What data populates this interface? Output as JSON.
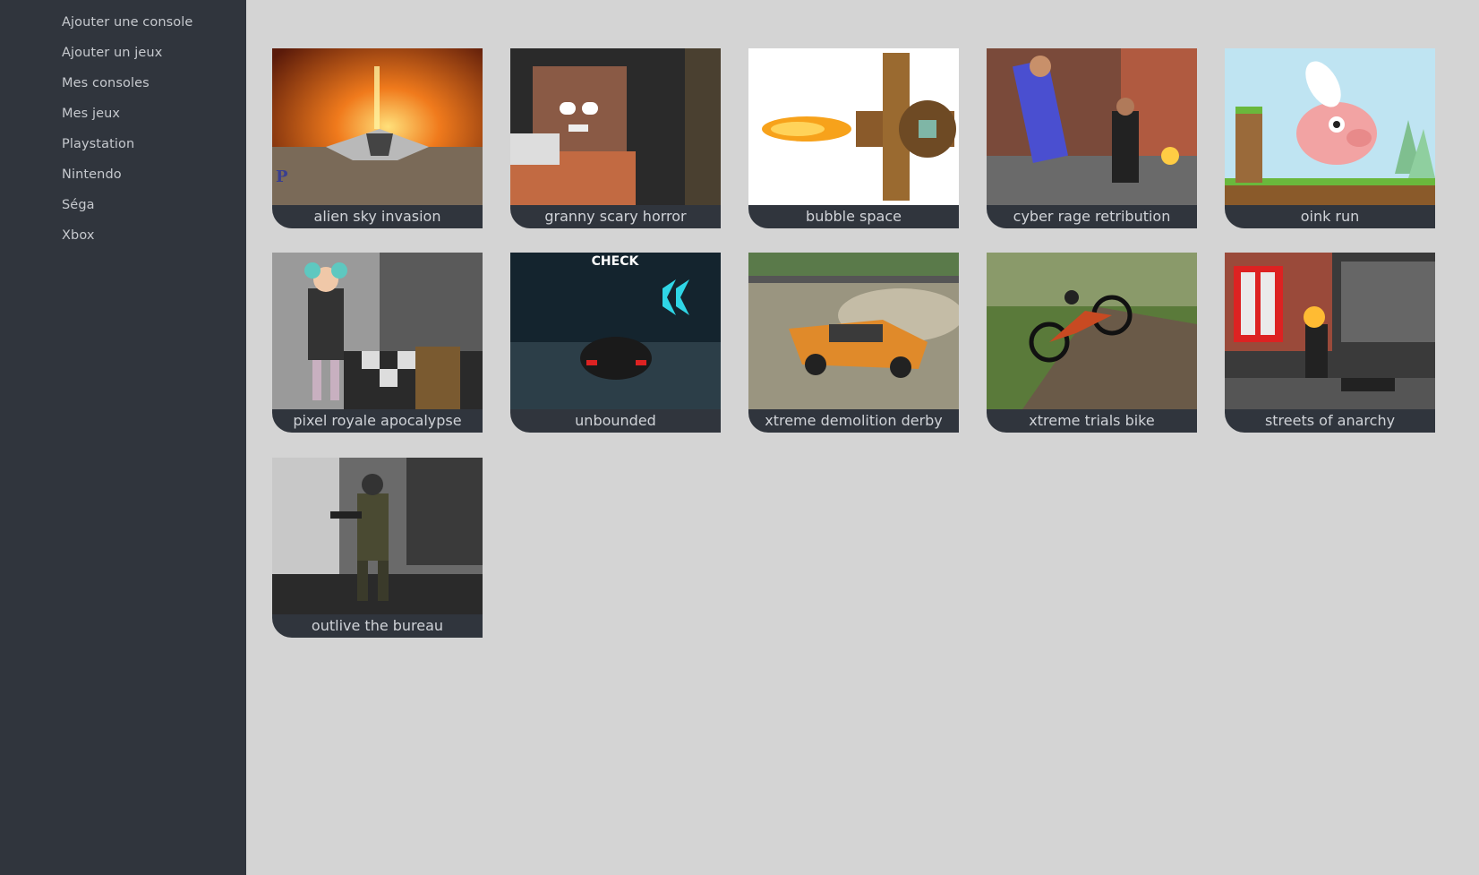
{
  "sidebar": {
    "items": [
      {
        "label": "Ajouter une console"
      },
      {
        "label": "Ajouter un jeux"
      },
      {
        "label": "Mes consoles"
      },
      {
        "label": "Mes jeux"
      },
      {
        "label": "Playstation"
      },
      {
        "label": "Nintendo"
      },
      {
        "label": "Séga"
      },
      {
        "label": "Xbox"
      }
    ]
  },
  "games": [
    {
      "title": "alien sky invasion",
      "badge": "P"
    },
    {
      "title": "granny scary horror"
    },
    {
      "title": "bubble space"
    },
    {
      "title": "cyber rage retribution"
    },
    {
      "title": "oink run"
    },
    {
      "title": "pixel royale apocalypse"
    },
    {
      "title": "unbounded",
      "overlay": "CHECK"
    },
    {
      "title": "xtreme demolition derby"
    },
    {
      "title": "xtreme trials bike"
    },
    {
      "title": "streets of anarchy"
    },
    {
      "title": "outlive the bureau"
    }
  ]
}
